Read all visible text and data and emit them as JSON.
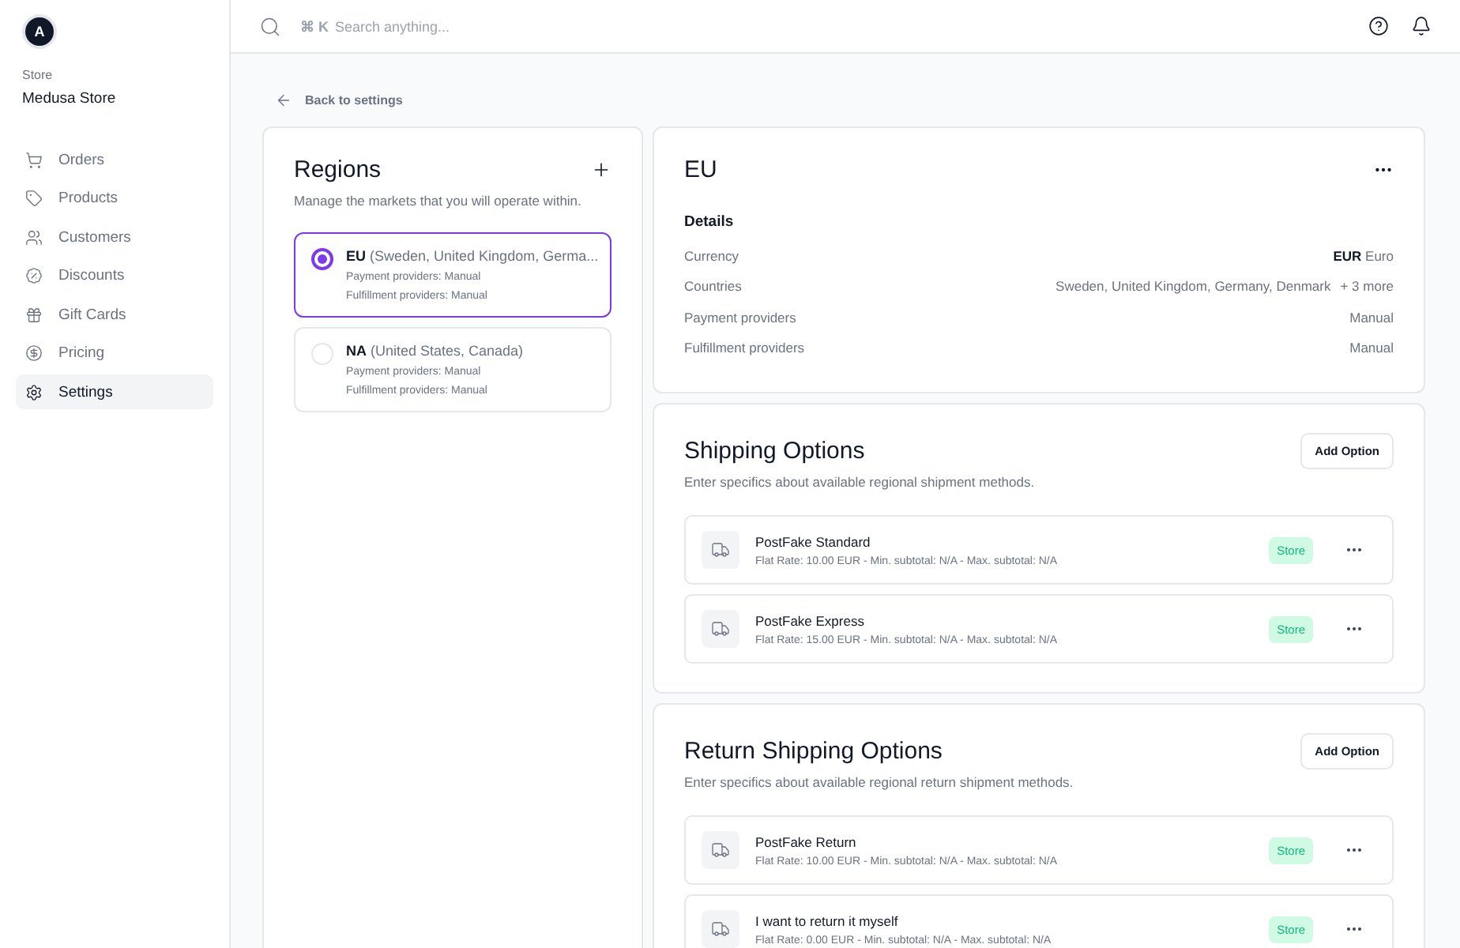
{
  "sidebar": {
    "avatar": "A",
    "store_label": "Store",
    "store_name": "Medusa Store",
    "items": [
      {
        "label": "Orders",
        "selected": false
      },
      {
        "label": "Products",
        "selected": false
      },
      {
        "label": "Customers",
        "selected": false
      },
      {
        "label": "Discounts",
        "selected": false
      },
      {
        "label": "Gift Cards",
        "selected": false
      },
      {
        "label": "Pricing",
        "selected": false
      },
      {
        "label": "Settings",
        "selected": true
      }
    ]
  },
  "topbar": {
    "shortcut": "⌘ K",
    "search_placeholder": "Search anything..."
  },
  "back_link": "Back to settings",
  "regions": {
    "title": "Regions",
    "subtitle": "Manage the markets that you will operate within.",
    "items": [
      {
        "text": "**EU** (Sweden, United Kingdom, Germa...",
        "payment": "Payment providers: Manual",
        "fulfillment": "Fulfillment providers: Manual",
        "selected": true
      },
      {
        "text": "**NA** (United States, Canada)",
        "payment": "Payment providers: Manual",
        "fulfillment": "Fulfillment providers: Manual",
        "selected": false
      }
    ]
  },
  "detail": {
    "title": "EU",
    "section": "Details",
    "rows": [
      {
        "label": "Currency",
        "value": "**EUR** Euro"
      },
      {
        "label": "Countries",
        "value": "Sweden, United Kingdom, Germany, Denmark",
        "extra": "+ 3 more"
      },
      {
        "label": "Payment providers",
        "value": "Manual"
      },
      {
        "label": "Fulfillment providers",
        "value": "Manual"
      }
    ]
  },
  "option_sections": [
    {
      "title": "Shipping Options",
      "subtitle": "Enter specifics about available regional shipment methods.",
      "button": "Add Option",
      "options": [
        {
          "name": "PostFake Standard",
          "details": "Flat Rate: 10.00 EUR - Min. subtotal: N/A - Max. subtotal: N/A",
          "badge": "Store"
        },
        {
          "name": "PostFake Express",
          "details": "Flat Rate: 15.00 EUR - Min. subtotal: N/A - Max. subtotal: N/A",
          "badge": "Store"
        }
      ]
    },
    {
      "title": "Return Shipping Options",
      "subtitle": "Enter specifics about available regional return shipment methods.",
      "button": "Add Option",
      "options": [
        {
          "name": "PostFake Return",
          "details": "Flat Rate: 10.00 EUR - Min. subtotal: N/A - Max. subtotal: N/A",
          "badge": "Store"
        },
        {
          "name": "I want to return it myself",
          "details": "Flat Rate: 0.00 EUR - Min. subtotal: N/A - Max. subtotal: N/A",
          "badge": "Store"
        }
      ]
    }
  ]
}
